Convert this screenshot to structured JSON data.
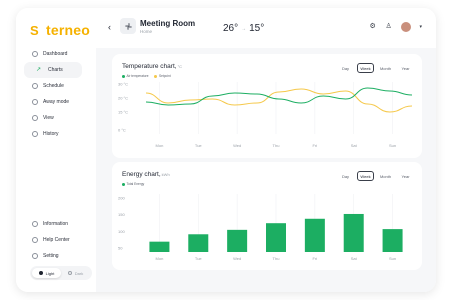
{
  "brand": {
    "name": "terneo",
    "mark": "S"
  },
  "sidebar": {
    "items": [
      {
        "label": "Dashboard",
        "icon": "dashboard-icon"
      },
      {
        "label": "Charts",
        "icon": "trend-icon",
        "active": true
      },
      {
        "label": "Schedule",
        "icon": "schedule-icon"
      },
      {
        "label": "Away mode",
        "icon": "away-icon"
      },
      {
        "label": "View",
        "icon": "view-icon"
      },
      {
        "label": "History",
        "icon": "history-icon"
      }
    ],
    "bottom_items": [
      {
        "label": "Information",
        "icon": "info-icon"
      },
      {
        "label": "Help Center",
        "icon": "help-icon"
      },
      {
        "label": "Setting",
        "icon": "gear-icon"
      }
    ],
    "theme": {
      "light": "Light",
      "dark": "Dark",
      "selected": "Light"
    }
  },
  "header": {
    "title": "Meeting Room",
    "subtitle": "Home",
    "temp_current": "26°",
    "temp_target": "15°"
  },
  "colors": {
    "brand": "#f5b100",
    "green": "#1cae62",
    "yellow": "#f5c84a"
  },
  "temperature_card": {
    "title": "Temperature chart,",
    "unit": "°C",
    "periods": [
      "Day",
      "Week",
      "Month",
      "Year"
    ],
    "selected_period": "Week",
    "legend": [
      "Air temperature",
      "Setpoint"
    ]
  },
  "energy_card": {
    "title": "Energy chart,",
    "unit": "kWh",
    "periods": [
      "Day",
      "Week",
      "Month",
      "Year"
    ],
    "selected_period": "Week",
    "legend": [
      "Total Energy"
    ]
  },
  "chart_data": [
    {
      "type": "line",
      "title": "Temperature chart, °C",
      "categories": [
        "Mon",
        "Tue",
        "Wed",
        "Thu",
        "Fri",
        "Sat",
        "Sun"
      ],
      "yticks": [
        "30 °C",
        "20 °C",
        "15 °C",
        "0 °C"
      ],
      "ylim": [
        0,
        30
      ],
      "grid": true,
      "legend_position": "top-left",
      "series": [
        {
          "name": "Air temperature",
          "color": "#1cae62",
          "values": [
            16,
            14.5,
            15,
            19,
            20.5,
            20,
            17.5,
            15.5,
            19,
            17.5,
            23,
            21.5,
            19.5
          ]
        },
        {
          "name": "Setpoint",
          "color": "#f5c84a",
          "values": [
            20.5,
            15.5,
            17,
            17.5,
            14.5,
            15.5,
            21,
            22.5,
            20,
            21.5,
            15,
            11,
            14
          ]
        }
      ]
    },
    {
      "type": "bar",
      "title": "Energy chart, kWh",
      "categories": [
        "Mon",
        "Tue",
        "Wed",
        "Thu",
        "Fri",
        "Sat",
        "Sun"
      ],
      "yticks": [
        "200",
        "150",
        "100",
        "50"
      ],
      "ylim": [
        0,
        200
      ],
      "values": [
        28,
        48,
        60,
        78,
        90,
        103,
        62
      ],
      "series": [
        {
          "name": "Total Energy",
          "color": "#1cae62"
        }
      ]
    }
  ]
}
